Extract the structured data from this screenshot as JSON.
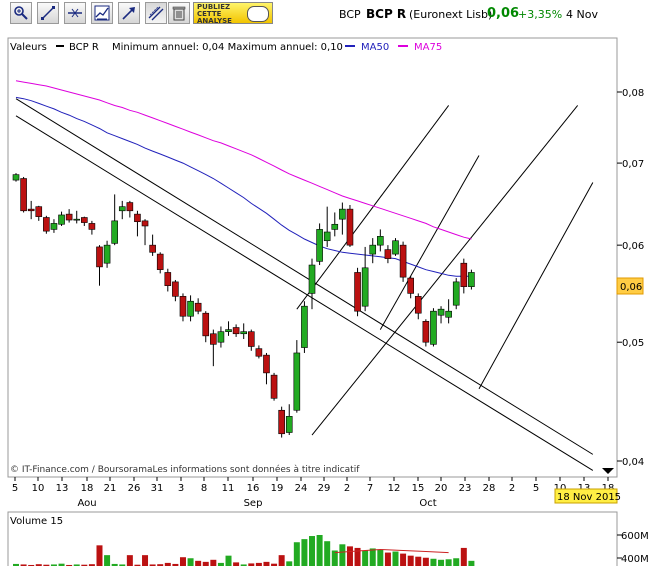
{
  "toolbar": {
    "buttons": [
      {
        "icon": "zoom-icon"
      },
      {
        "icon": "draw-line-icon"
      },
      {
        "icon": "horizontal-line-icon"
      },
      {
        "icon": "indicator-icon"
      },
      {
        "icon": "trend-arrow-icon"
      },
      {
        "icon": "parallel-channel-icon"
      },
      {
        "icon": "trash-icon"
      }
    ],
    "promo_label": "PUBLIEZ CETTE ANALYSE"
  },
  "quote": {
    "symbol": "BCP",
    "name": "BCP R",
    "market": "(Euronext Lisb)",
    "price": "0,06",
    "change": "+3,35%",
    "date": "4 Nov",
    "price_color": "#008800",
    "change_color": "#008800"
  },
  "legend": {
    "values_label": "Valeurs",
    "series_name": "BCP R",
    "range_text": "Minimum annuel: 0,04 Maximum annuel: 0,10",
    "ma50": "MA50",
    "ma75": "MA75",
    "ma50_color": "#2222bb",
    "ma75_color": "#dd00dd"
  },
  "credit": "© IT-Finance.com / BoursoramaLes informations sont données à titre indicatif",
  "last_price_tag": "0,06",
  "date_tag": "18 Nov 2015",
  "volume_label": "Volume 15",
  "chart_data": {
    "type": "candlestick",
    "y_scale": "log",
    "ylim": [
      0.04,
      0.087
    ],
    "y_ticks": [
      "0,08",
      "0,07",
      "0,06",
      "0,05",
      "0,04"
    ],
    "x_ticks": [
      "5",
      "10",
      "13",
      "18",
      "21",
      "26",
      "31",
      "3",
      "8",
      "11",
      "16",
      "19",
      "24",
      "29",
      "2",
      "7",
      "12",
      "15",
      "20",
      "23",
      "28",
      "2",
      "5",
      "10",
      "13",
      "18"
    ],
    "month_labels": [
      "Aou",
      "Sep",
      "Oct"
    ],
    "up_color": "#22aa22",
    "down_color": "#bb1111",
    "candles": [
      [
        0.0678,
        0.0685,
        0.0676,
        0.0687
      ],
      [
        0.068,
        0.064,
        0.0638,
        0.0682
      ],
      [
        0.0642,
        0.064,
        0.063,
        0.0652
      ],
      [
        0.0645,
        0.0633,
        0.0628,
        0.0646
      ],
      [
        0.0632,
        0.0616,
        0.0613,
        0.0634
      ],
      [
        0.0618,
        0.0625,
        0.0614,
        0.063
      ],
      [
        0.0624,
        0.0635,
        0.0622,
        0.0639
      ],
      [
        0.0636,
        0.0629,
        0.0626,
        0.0642
      ],
      [
        0.063,
        0.063,
        0.0625,
        0.064
      ],
      [
        0.0632,
        0.0626,
        0.0622,
        0.0633
      ],
      [
        0.0625,
        0.0618,
        0.0612,
        0.0628
      ],
      [
        0.0598,
        0.0576,
        0.0556,
        0.06
      ],
      [
        0.058,
        0.06,
        0.0575,
        0.0605
      ],
      [
        0.0602,
        0.0628,
        0.06,
        0.066
      ],
      [
        0.064,
        0.0645,
        0.063,
        0.0652
      ],
      [
        0.065,
        0.064,
        0.0632,
        0.0652
      ],
      [
        0.0636,
        0.0627,
        0.061,
        0.064
      ],
      [
        0.0628,
        0.0622,
        0.06,
        0.063
      ],
      [
        0.06,
        0.0592,
        0.0588,
        0.0612
      ],
      [
        0.059,
        0.0573,
        0.0569,
        0.0592
      ],
      [
        0.057,
        0.0556,
        0.055,
        0.0574
      ],
      [
        0.056,
        0.0545,
        0.054,
        0.0562
      ],
      [
        0.0545,
        0.0525,
        0.052,
        0.0548
      ],
      [
        0.0525,
        0.054,
        0.052,
        0.0546
      ],
      [
        0.0538,
        0.053,
        0.0527,
        0.0543
      ],
      [
        0.0528,
        0.0506,
        0.05,
        0.053
      ],
      [
        0.0508,
        0.0498,
        0.0478,
        0.0512
      ],
      [
        0.05,
        0.051,
        0.0495,
        0.0515
      ],
      [
        0.051,
        0.0512,
        0.0506,
        0.052
      ],
      [
        0.0514,
        0.0508,
        0.0505,
        0.0517
      ],
      [
        0.0508,
        0.051,
        0.0503,
        0.0518
      ],
      [
        0.051,
        0.0496,
        0.0492,
        0.0512
      ],
      [
        0.0494,
        0.0487,
        0.0485,
        0.0497
      ],
      [
        0.0488,
        0.0472,
        0.0462,
        0.049
      ],
      [
        0.047,
        0.045,
        0.0448,
        0.0472
      ],
      [
        0.044,
        0.0421,
        0.0418,
        0.0443
      ],
      [
        0.0422,
        0.0435,
        0.042,
        0.0445
      ],
      [
        0.044,
        0.049,
        0.0438,
        0.0502
      ],
      [
        0.0495,
        0.0535,
        0.049,
        0.054
      ],
      [
        0.0548,
        0.0578,
        0.0532,
        0.0585
      ],
      [
        0.0582,
        0.0618,
        0.0578,
        0.0625
      ],
      [
        0.0605,
        0.0615,
        0.0598,
        0.0645
      ],
      [
        0.0618,
        0.0624,
        0.061,
        0.0638
      ],
      [
        0.063,
        0.0642,
        0.0612,
        0.065
      ],
      [
        0.0642,
        0.06,
        0.0598,
        0.0647
      ],
      [
        0.057,
        0.053,
        0.0525,
        0.0575
      ],
      [
        0.0535,
        0.0575,
        0.053,
        0.0598
      ],
      [
        0.059,
        0.06,
        0.058,
        0.0608
      ],
      [
        0.06,
        0.061,
        0.0593,
        0.0618
      ],
      [
        0.0595,
        0.0585,
        0.058,
        0.06
      ],
      [
        0.059,
        0.0605,
        0.0588,
        0.0608
      ],
      [
        0.06,
        0.0565,
        0.056,
        0.0604
      ],
      [
        0.0564,
        0.0548,
        0.0543,
        0.0566
      ],
      [
        0.0545,
        0.0528,
        0.0522,
        0.0548
      ],
      [
        0.052,
        0.05,
        0.0496,
        0.0522
      ],
      [
        0.0498,
        0.053,
        0.0496,
        0.0533
      ],
      [
        0.0526,
        0.0532,
        0.0518,
        0.0535
      ],
      [
        0.0524,
        0.053,
        0.0518,
        0.0542
      ],
      [
        0.0536,
        0.056,
        0.0532,
        0.0564
      ],
      [
        0.058,
        0.0555,
        0.0548,
        0.0585
      ],
      [
        0.0555,
        0.057,
        0.0552,
        0.0573
      ]
    ],
    "ma50": [
      0.0792,
      0.079,
      0.0787,
      0.0783,
      0.0779,
      0.0775,
      0.077,
      0.0766,
      0.0761,
      0.0757,
      0.0752,
      0.0747,
      0.0741,
      0.0737,
      0.0733,
      0.0729,
      0.0725,
      0.072,
      0.0716,
      0.0712,
      0.0708,
      0.0704,
      0.07,
      0.0695,
      0.069,
      0.0685,
      0.068,
      0.0674,
      0.0668,
      0.0662,
      0.0656,
      0.0649,
      0.0643,
      0.0637,
      0.063,
      0.0623,
      0.0617,
      0.0612,
      0.0607,
      0.0603,
      0.0599,
      0.0596,
      0.0594,
      0.0592,
      0.0591,
      0.059,
      0.0589,
      0.0588,
      0.0587,
      0.0586,
      0.0585,
      0.0582,
      0.0579,
      0.0576,
      0.0573,
      0.0571,
      0.0569,
      0.0567,
      0.0566,
      0.0566,
      0.0566
    ],
    "ma75": [
      0.0817,
      0.0815,
      0.0813,
      0.0811,
      0.0809,
      0.0806,
      0.0803,
      0.08,
      0.0797,
      0.0794,
      0.0791,
      0.0788,
      0.0784,
      0.078,
      0.0777,
      0.0773,
      0.077,
      0.0766,
      0.0762,
      0.0758,
      0.0754,
      0.075,
      0.0746,
      0.0742,
      0.0738,
      0.0734,
      0.073,
      0.0727,
      0.0723,
      0.0719,
      0.0715,
      0.0711,
      0.0706,
      0.0701,
      0.0696,
      0.0691,
      0.0686,
      0.0682,
      0.0678,
      0.0674,
      0.067,
      0.0666,
      0.0662,
      0.0658,
      0.0655,
      0.0652,
      0.0649,
      0.0646,
      0.0643,
      0.064,
      0.0637,
      0.0634,
      0.0631,
      0.0628,
      0.0625,
      0.0621,
      0.0618,
      0.0615,
      0.0612,
      0.0609,
      0.0607
    ],
    "trendlines": [
      [
        [
          0,
          0.079
        ],
        [
          76,
          0.0405
        ]
      ],
      [
        [
          0,
          0.0765
        ],
        [
          76,
          0.0393
        ]
      ],
      [
        [
          37,
          0.0532
        ],
        [
          57,
          0.078
        ]
      ],
      [
        [
          39,
          0.042
        ],
        [
          74,
          0.078
        ]
      ],
      [
        [
          48,
          0.0512
        ],
        [
          61,
          0.071
        ]
      ],
      [
        [
          61,
          0.0458
        ],
        [
          76,
          0.0675
        ]
      ]
    ],
    "volume": {
      "ylim": [
        0,
        650
      ],
      "y_ticks": [
        "600M",
        "400M"
      ],
      "bars": [
        40,
        30,
        20,
        35,
        25,
        30,
        45,
        20,
        30,
        25,
        35,
        400,
        210,
        40,
        30,
        210,
        25,
        210,
        30,
        35,
        60,
        40,
        170,
        150,
        100,
        80,
        120,
        60,
        200,
        70,
        30,
        50,
        60,
        80,
        45,
        210,
        90,
        460,
        520,
        580,
        600,
        480,
        300,
        420,
        380,
        350,
        300,
        340,
        310,
        260,
        280,
        240,
        200,
        180,
        160,
        140,
        120,
        130,
        150,
        350,
        100
      ],
      "ma_points": [
        [
          42,
          260
        ],
        [
          45,
          290
        ],
        [
          48,
          320
        ],
        [
          51,
          300
        ],
        [
          54,
          280
        ],
        [
          57,
          260
        ]
      ],
      "ma_color": "#cc2222"
    }
  }
}
